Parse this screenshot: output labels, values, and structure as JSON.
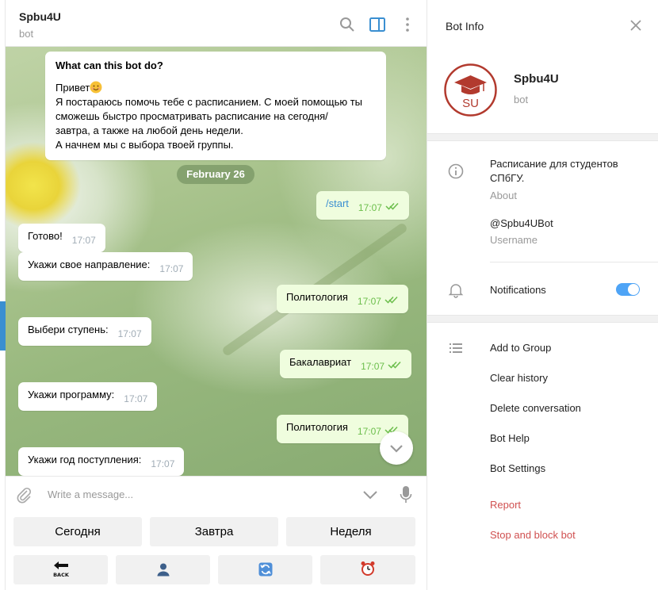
{
  "chat": {
    "title": "Spbu4U",
    "subtitle": "bot",
    "intro": {
      "title": "What can this bot do?",
      "greeting": "Привет",
      "lines": [
        "Я постараюсь помочь тебе с расписанием. С моей помощью ты",
        "сможешь быстро просматривать расписание на сегодня/",
        "завтра, а также на любой день недели.",
        "А начнем мы с выбора твоей группы."
      ]
    },
    "date_pill": "February 26",
    "messages": [
      {
        "text": "/start",
        "time": "17:07",
        "dir": "out"
      },
      {
        "text": "Готово!",
        "time": "17:07",
        "dir": "in"
      },
      {
        "text": "Укажи свое направление:",
        "time": "17:07",
        "dir": "in"
      },
      {
        "text": "Политология",
        "time": "17:07",
        "dir": "out"
      },
      {
        "text": "Выбери ступень:",
        "time": "17:07",
        "dir": "in"
      },
      {
        "text": "Бакалавриат",
        "time": "17:07",
        "dir": "out"
      },
      {
        "text": "Укажи программу:",
        "time": "17:07",
        "dir": "in"
      },
      {
        "text": "Политология",
        "time": "17:07",
        "dir": "out"
      },
      {
        "text": "Укажи год поступления:",
        "time": "17:07",
        "dir": "in"
      }
    ],
    "composer_placeholder": "Write a message...",
    "keyboard_row1": [
      "Сегодня",
      "Завтра",
      "Неделя"
    ],
    "keyboard_row2_icons": [
      "back-icon",
      "user-icon",
      "refresh-icon",
      "alarm-clock-icon"
    ],
    "back_label": "BACK"
  },
  "info": {
    "title": "Bot Info",
    "bot_name": "Spbu4U",
    "bot_sub": "bot",
    "avatar_text": "SU",
    "about_text_1": "Расписание для студентов",
    "about_text_2": "СПбГУ.",
    "about_label": "About",
    "username": "@Spbu4UBot",
    "username_label": "Username",
    "notifications_label": "Notifications",
    "notifications_on": true,
    "actions": [
      "Add to Group",
      "Clear history",
      "Delete conversation",
      "Bot Help",
      "Bot Settings"
    ],
    "danger_actions": [
      "Report",
      "Stop and block bot"
    ]
  },
  "colors": {
    "accent": "#4ea4f6",
    "outgoing": "#effdde",
    "danger": "#d05050",
    "avatar": "#b23a2e"
  }
}
